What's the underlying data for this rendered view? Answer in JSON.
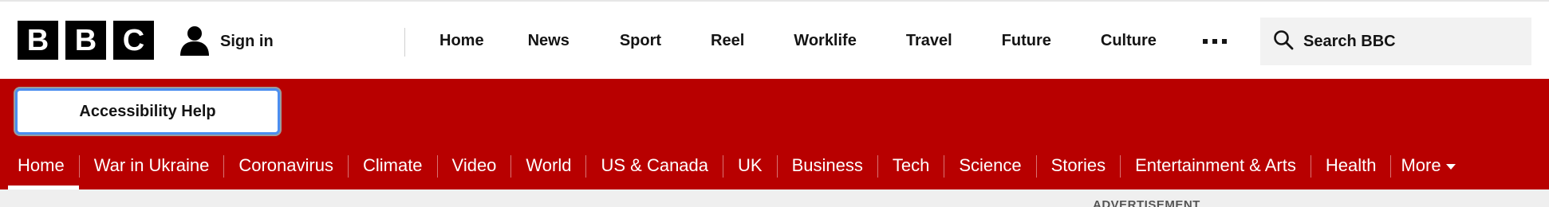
{
  "header": {
    "logo_letters": [
      "B",
      "B",
      "C"
    ],
    "sign_in_label": "Sign in",
    "nav": [
      {
        "label": "Home"
      },
      {
        "label": "News"
      },
      {
        "label": "Sport"
      },
      {
        "label": "Reel"
      },
      {
        "label": "Worklife"
      },
      {
        "label": "Travel"
      },
      {
        "label": "Future"
      },
      {
        "label": "Culture"
      }
    ],
    "more_icon": "more-dots-icon",
    "search_placeholder": "Search BBC"
  },
  "accessibility_button_label": "Accessibility Help",
  "section_nav": {
    "active": "Home",
    "items": [
      {
        "label": "Home"
      },
      {
        "label": "War in Ukraine"
      },
      {
        "label": "Coronavirus"
      },
      {
        "label": "Climate"
      },
      {
        "label": "Video"
      },
      {
        "label": "World"
      },
      {
        "label": "US & Canada"
      },
      {
        "label": "UK"
      },
      {
        "label": "Business"
      },
      {
        "label": "Tech"
      },
      {
        "label": "Science"
      },
      {
        "label": "Stories"
      },
      {
        "label": "Entertainment & Arts"
      },
      {
        "label": "Health"
      },
      {
        "label": "More"
      }
    ]
  },
  "advertisement_label": "ADVERTISEMENT",
  "colors": {
    "brand_red": "#b80000",
    "focus_blue": "#4b8ef0",
    "logo_black": "#000000"
  }
}
